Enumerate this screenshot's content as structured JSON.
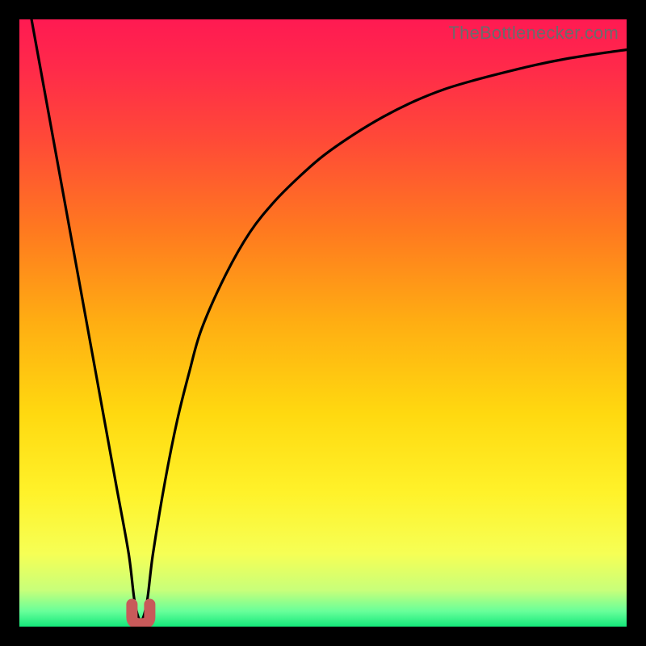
{
  "watermark": "TheBottlenecker.com",
  "colors": {
    "frame": "#000000",
    "curve": "#000000",
    "marker": "#c85a5a",
    "gradient_stops": [
      {
        "offset": 0.0,
        "color": "#ff1a52"
      },
      {
        "offset": 0.08,
        "color": "#ff2a4a"
      },
      {
        "offset": 0.2,
        "color": "#ff4a37"
      },
      {
        "offset": 0.35,
        "color": "#ff7a1f"
      },
      {
        "offset": 0.5,
        "color": "#ffae12"
      },
      {
        "offset": 0.65,
        "color": "#ffd910"
      },
      {
        "offset": 0.78,
        "color": "#fff22a"
      },
      {
        "offset": 0.88,
        "color": "#f6ff55"
      },
      {
        "offset": 0.94,
        "color": "#c8ff7a"
      },
      {
        "offset": 0.975,
        "color": "#67ff9a"
      },
      {
        "offset": 1.0,
        "color": "#14e87a"
      }
    ]
  },
  "chart_data": {
    "type": "line",
    "title": "",
    "xlabel": "",
    "ylabel": "",
    "xlim": [
      0,
      100
    ],
    "ylim": [
      0,
      100
    ],
    "x": [
      2,
      4,
      6,
      8,
      10,
      12,
      14,
      16,
      18,
      19,
      20,
      21,
      22,
      24,
      26,
      28,
      30,
      34,
      38,
      42,
      46,
      50,
      55,
      60,
      65,
      70,
      75,
      80,
      85,
      90,
      95,
      100
    ],
    "series": [
      {
        "name": "bottleneck-curve",
        "values": [
          100,
          89,
          78,
          67,
          56,
          45,
          34,
          23,
          12,
          4,
          1,
          4,
          12,
          24,
          34,
          42,
          49,
          58,
          65,
          70,
          74,
          77.5,
          81,
          84,
          86.5,
          88.5,
          90,
          91.3,
          92.5,
          93.5,
          94.3,
          95
        ]
      }
    ],
    "annotations": [
      {
        "name": "min-marker",
        "x": 20,
        "y": 1
      }
    ],
    "legend": false,
    "grid": false
  }
}
